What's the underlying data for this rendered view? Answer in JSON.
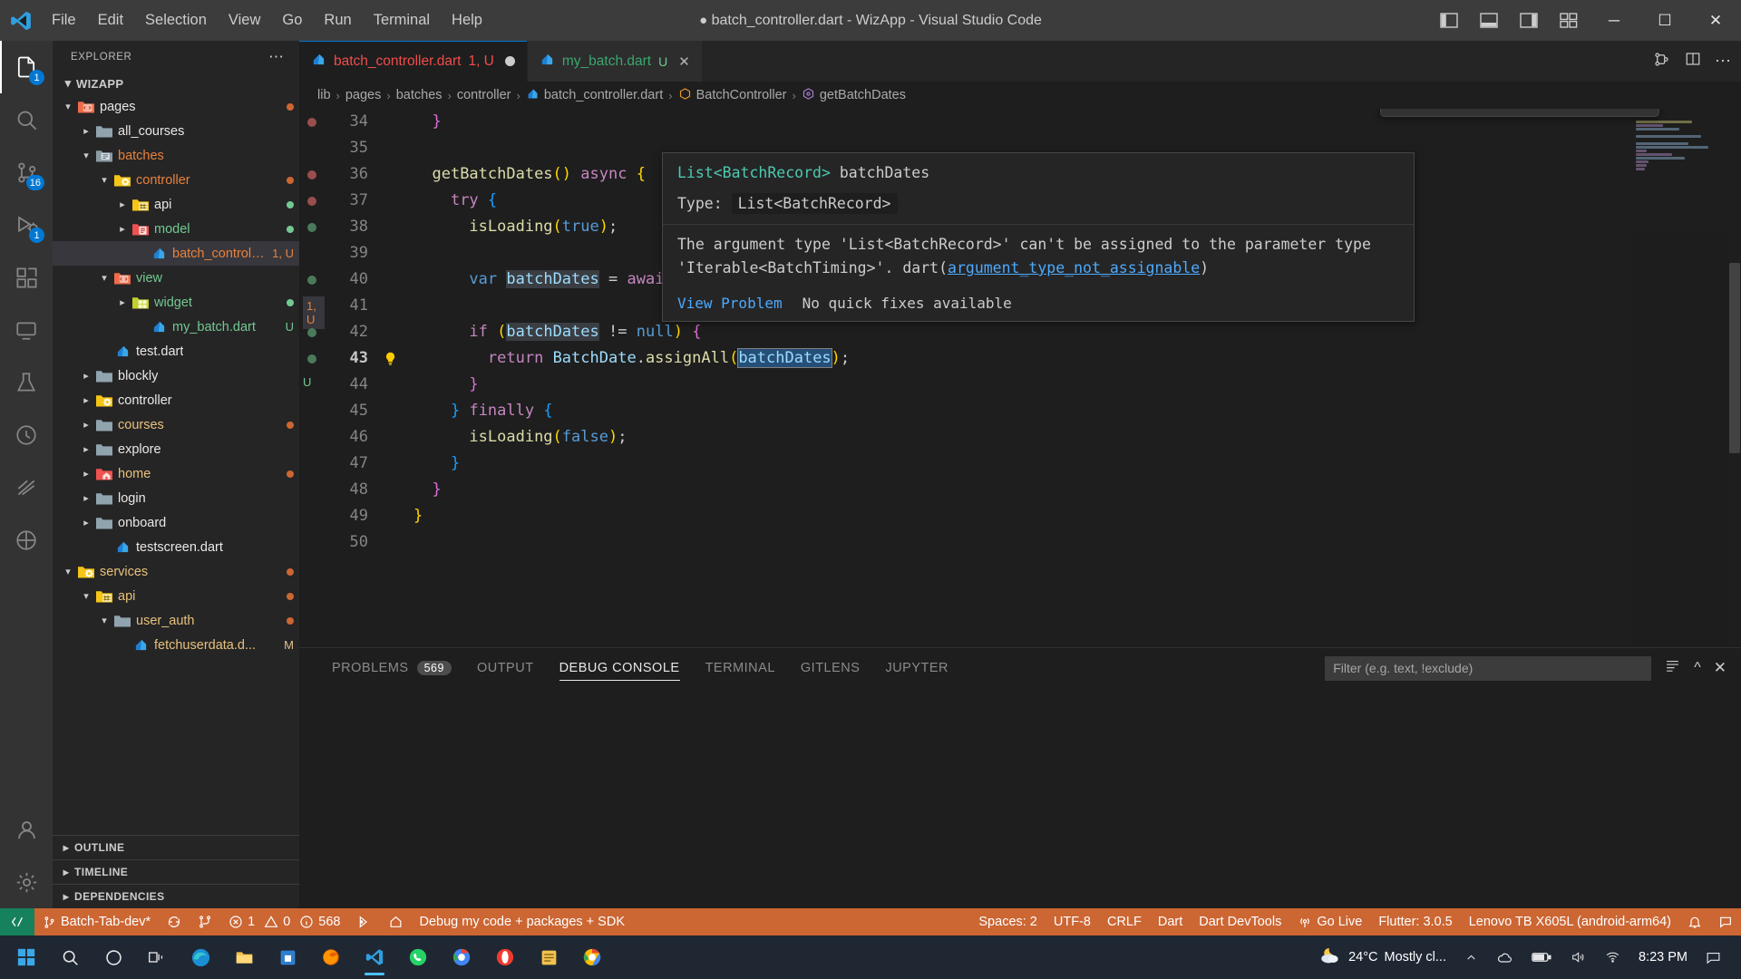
{
  "titlebar": {
    "menus": [
      "File",
      "Edit",
      "Selection",
      "View",
      "Go",
      "Run",
      "Terminal",
      "Help"
    ],
    "dirty_indicator": "●",
    "title": "batch_controller.dart - WizApp - Visual Studio Code",
    "window_minimize": "─",
    "window_maximize": "☐",
    "window_close": "✕"
  },
  "activitybar": {
    "explorer_badge": "1",
    "scm_badge": "16",
    "debug_badge": "1"
  },
  "sidebar": {
    "header": "EXPLORER",
    "more": "⋯",
    "root": "WIZAPP",
    "items": [
      {
        "label": "pages",
        "indent": 1,
        "type": "folder",
        "twisty": "down",
        "icon": "folder-pages",
        "color": "#e8e8e8",
        "dot": "#cc6633"
      },
      {
        "label": "all_courses",
        "indent": 2,
        "type": "folder",
        "twisty": "right",
        "icon": "folder-plain",
        "color": "#e8e8e8",
        "dot": ""
      },
      {
        "label": "batches",
        "indent": 2,
        "type": "folder",
        "twisty": "down",
        "icon": "folder-list",
        "color": "#e8823c",
        "dot": ""
      },
      {
        "label": "controller",
        "indent": 3,
        "type": "folder",
        "twisty": "down",
        "icon": "folder-gear",
        "color": "#e8823c",
        "dot": "#cc6633"
      },
      {
        "label": "api",
        "indent": 4,
        "type": "folder",
        "twisty": "right",
        "icon": "folder-api",
        "color": "#e8e8e8",
        "dot": "#73c991"
      },
      {
        "label": "model",
        "indent": 4,
        "type": "folder",
        "twisty": "right",
        "icon": "folder-model",
        "color": "#73c991",
        "dot": "#73c991"
      },
      {
        "label": "batch_controll...",
        "indent": 5,
        "type": "file",
        "twisty": "",
        "icon": "dart-file",
        "color": "#e8823c",
        "badge": "1, U",
        "badge_color": "#e8823c",
        "selected": true
      },
      {
        "label": "view",
        "indent": 3,
        "type": "folder",
        "twisty": "down",
        "icon": "folder-pages",
        "color": "#73c991",
        "dot": ""
      },
      {
        "label": "widget",
        "indent": 4,
        "type": "folder",
        "twisty": "right",
        "icon": "folder-widget",
        "color": "#73c991",
        "dot": "#73c991"
      },
      {
        "label": "my_batch.dart",
        "indent": 5,
        "type": "file",
        "twisty": "",
        "icon": "dart-file",
        "color": "#73c991",
        "badge": "U",
        "badge_color": "#73c991"
      },
      {
        "label": "test.dart",
        "indent": 3,
        "type": "file",
        "twisty": "",
        "icon": "dart-file",
        "color": "#e8e8e8",
        "dot": ""
      },
      {
        "label": "blockly",
        "indent": 2,
        "type": "folder",
        "twisty": "right",
        "icon": "folder-plain",
        "color": "#e8e8e8",
        "dot": ""
      },
      {
        "label": "controller",
        "indent": 2,
        "type": "folder",
        "twisty": "right",
        "icon": "folder-gear",
        "color": "#e8e8e8",
        "dot": ""
      },
      {
        "label": "courses",
        "indent": 2,
        "type": "folder",
        "twisty": "right",
        "icon": "folder-plain",
        "color": "#e8c17a",
        "dot": "#cc6633"
      },
      {
        "label": "explore",
        "indent": 2,
        "type": "folder",
        "twisty": "right",
        "icon": "folder-plain",
        "color": "#e8e8e8",
        "dot": ""
      },
      {
        "label": "home",
        "indent": 2,
        "type": "folder",
        "twisty": "right",
        "icon": "folder-home",
        "color": "#e8c17a",
        "dot": "#cc6633"
      },
      {
        "label": "login",
        "indent": 2,
        "type": "folder",
        "twisty": "right",
        "icon": "folder-plain",
        "color": "#e8e8e8",
        "dot": ""
      },
      {
        "label": "onboard",
        "indent": 2,
        "type": "folder",
        "twisty": "right",
        "icon": "folder-plain",
        "color": "#e8e8e8",
        "dot": ""
      },
      {
        "label": "testscreen.dart",
        "indent": 3,
        "type": "file",
        "twisty": "",
        "icon": "dart-file",
        "color": "#e8e8e8",
        "dot": ""
      },
      {
        "label": "services",
        "indent": 1,
        "type": "folder",
        "twisty": "down",
        "icon": "folder-gear",
        "color": "#e8c17a",
        "dot": "#cc6633"
      },
      {
        "label": "api",
        "indent": 2,
        "type": "folder",
        "twisty": "down",
        "icon": "folder-api",
        "color": "#e8c17a",
        "dot": "#cc6633"
      },
      {
        "label": "user_auth",
        "indent": 3,
        "type": "folder",
        "twisty": "down",
        "icon": "folder-plain",
        "color": "#e8c17a",
        "dot": "#cc6633"
      },
      {
        "label": "fetchuserdata.d...",
        "indent": 4,
        "type": "file",
        "twisty": "",
        "icon": "dart-file",
        "color": "#e8c17a",
        "badge": "M",
        "badge_color": "#e2c08d"
      }
    ],
    "sections": [
      "OUTLINE",
      "TIMELINE",
      "DEPENDENCIES"
    ]
  },
  "editor": {
    "tabs": [
      {
        "label": "batch_controller.dart",
        "badge": "1, U",
        "active": true,
        "dirty": true,
        "icon": "dart-file",
        "label_color": "#f14c4c",
        "badge_color": "#f14c4c"
      },
      {
        "label": "my_batch.dart",
        "badge": "U",
        "active": false,
        "dirty": false,
        "icon": "dart-file",
        "label_color": "#73c991",
        "badge_color": "#73c991"
      }
    ],
    "breadcrumb": [
      "lib",
      "pages",
      "batches",
      "controller",
      "batch_controller.dart",
      "BatchController",
      "getBatchDates"
    ],
    "breadcrumb_separator": "›",
    "lines": [
      {
        "n": "34",
        "marker": "error"
      },
      {
        "n": "35",
        "marker": ""
      },
      {
        "n": "36",
        "marker": "error"
      },
      {
        "n": "37",
        "marker": "error"
      },
      {
        "n": "38",
        "marker": "ok"
      },
      {
        "n": "39",
        "marker": ""
      },
      {
        "n": "40",
        "marker": "ok"
      },
      {
        "n": "41",
        "marker": "badge"
      },
      {
        "n": "42",
        "marker": "ok"
      },
      {
        "n": "43",
        "marker": "ok",
        "current": true,
        "bulb": true
      },
      {
        "n": "44",
        "marker": "badge2"
      },
      {
        "n": "45",
        "marker": ""
      },
      {
        "n": "46",
        "marker": ""
      },
      {
        "n": "47",
        "marker": ""
      },
      {
        "n": "48",
        "marker": ""
      },
      {
        "n": "49",
        "marker": ""
      },
      {
        "n": "50",
        "marker": ""
      }
    ],
    "gutter_badge_41": "1, U",
    "gutter_badge_44": "U",
    "code": [
      "  }",
      "",
      "  getBatchDates() async {",
      "    try {",
      "      isLoading(true);",
      "",
      "      var batchDates = await api.ge",
      "",
      "      if (batchDates != null) {",
      "        return BatchDate.assignAll(batchDates);",
      "      }",
      "    } finally {",
      "      isLoading(false);",
      "    }",
      "  }",
      "}",
      ""
    ]
  },
  "hover": {
    "signature_type": "List<BatchRecord>",
    "signature_name": "batchDates",
    "type_label": "Type:",
    "type_value": "List<BatchRecord>",
    "message_line1": "The argument type 'List<BatchRecord>' can't be assigned to the parameter type",
    "message_line2_pre": "'Iterable<BatchTiming>'. dart(",
    "message_link": "argument_type_not_assignable",
    "message_line2_post": ")",
    "action_view_problem": "View Problem",
    "action_quick_fix": "No quick fixes available"
  },
  "debug_toolbar": {
    "buttons": [
      "grip",
      "pause",
      "step-over",
      "step-into",
      "step-out",
      "hot-reload",
      "restart",
      "stop",
      "inspect-widget"
    ]
  },
  "panel": {
    "tabs": [
      {
        "label": "PROBLEMS",
        "badge": "569",
        "active": false
      },
      {
        "label": "OUTPUT",
        "badge": "",
        "active": false
      },
      {
        "label": "DEBUG CONSOLE",
        "badge": "",
        "active": true
      },
      {
        "label": "TERMINAL",
        "badge": "",
        "active": false
      },
      {
        "label": "GITLENS",
        "badge": "",
        "active": false
      },
      {
        "label": "JUPYTER",
        "badge": "",
        "active": false
      }
    ],
    "filter_placeholder": "Filter (e.g. text, !exclude)",
    "filter_value": ""
  },
  "statusbar": {
    "remote_icon": "remote-window-icon",
    "branch": "Batch-Tab-dev*",
    "sync_icon": "sync-icon",
    "errors": "1",
    "warnings": "0",
    "infos": "568",
    "debug_config": "Debug my code + packages + SDK",
    "right_items": [
      "Spaces: 2",
      "UTF-8",
      "CRLF",
      "Dart",
      "Dart DevTools",
      "Go Live",
      "Flutter: 3.0.5",
      "Lenovo TB X605L (android-arm64)"
    ],
    "bg_color": "#cc6633"
  },
  "taskbar": {
    "apps": [
      "start",
      "search",
      "cortana",
      "task-view",
      "edge",
      "file-explorer",
      "store",
      "outlook",
      "firefox",
      "vscode",
      "whatsapp",
      "chrome-alt",
      "opera",
      "notes",
      "chrome"
    ],
    "weather_temp": "24°C",
    "weather_desc": "Mostly cl...",
    "time": "8:23 PM",
    "tray_icons": [
      "chevron-up",
      "onedrive",
      "battery",
      "volume",
      "network"
    ]
  }
}
